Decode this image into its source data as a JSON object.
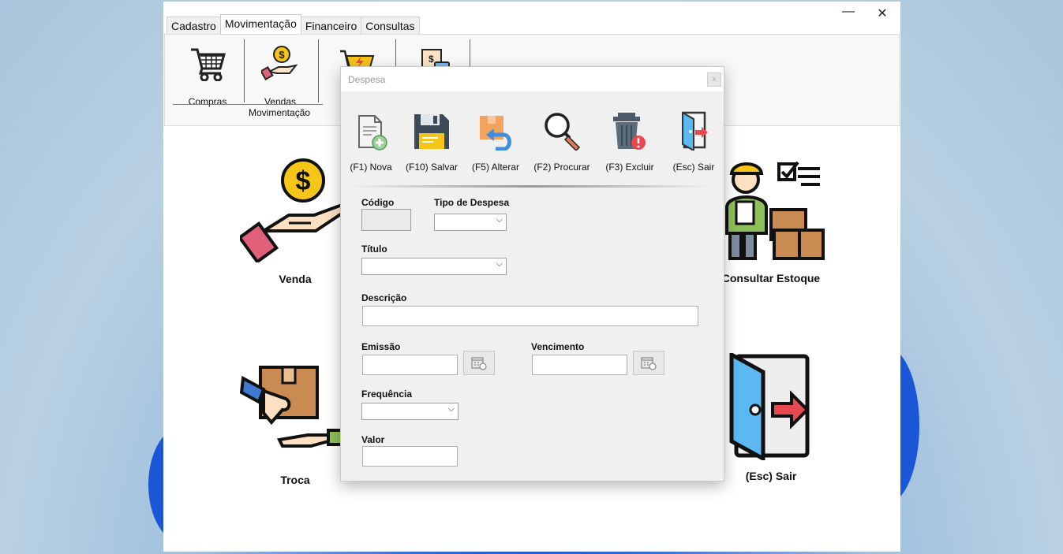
{
  "window": {
    "controls": {
      "minimize": "—",
      "close": "✕"
    },
    "tabs": [
      "Cadastro",
      "Movimentação",
      "Financeiro",
      "Consultas"
    ],
    "active_tab": "Movimentação",
    "ribbon": {
      "items": [
        {
          "label": "Compras",
          "icon": "shopping-cart-icon"
        },
        {
          "label": "Vendas",
          "icon": "hand-coin-icon"
        },
        {
          "label": "",
          "icon": "cart-lightning-icon"
        },
        {
          "label": "",
          "icon": "invoice-calculator-icon"
        }
      ],
      "group_label": "Movimentação"
    },
    "main_buttons": [
      {
        "label": "Venda",
        "icon": "hand-dollar-icon"
      },
      {
        "label": "Consultar Estoque",
        "icon": "delivery-man-boxes-icon"
      },
      {
        "label": "Troca",
        "icon": "box-handover-icon"
      },
      {
        "label": "(Esc) Sair",
        "icon": "exit-door-icon"
      }
    ]
  },
  "dialog": {
    "title": "Despesa",
    "close": "x",
    "toolbar": [
      {
        "label": "(F1) Nova",
        "icon": "new-document-icon"
      },
      {
        "label": "(F10) Salvar",
        "icon": "floppy-save-icon"
      },
      {
        "label": "(F5) Alterar",
        "icon": "edit-undo-box-icon"
      },
      {
        "label": "(F2) Procurar",
        "icon": "magnifier-icon"
      },
      {
        "label": "(F3) Excluir",
        "icon": "trash-icon"
      },
      {
        "label": "(Esc) Sair",
        "icon": "exit-door-icon"
      }
    ],
    "fields": {
      "codigo": {
        "label": "Código",
        "value": ""
      },
      "tipo_despesa": {
        "label": "Tipo de Despesa",
        "value": ""
      },
      "titulo": {
        "label": "Título",
        "value": ""
      },
      "descricao": {
        "label": "Descrição",
        "value": ""
      },
      "emissao": {
        "label": "Emissão",
        "value": ""
      },
      "vencimento": {
        "label": "Vencimento",
        "value": ""
      },
      "frequencia": {
        "label": "Frequência",
        "value": ""
      },
      "valor": {
        "label": "Valor",
        "value": ""
      }
    }
  },
  "colors": {
    "desktop_accent": "#1f4fd0",
    "dialog_bg": "#f0f0f0",
    "coin_yellow": "#f5c518",
    "sleeve_pink": "#e0607a",
    "exit_arrow_red": "#e8484f",
    "door_blue": "#5bb8f0"
  }
}
